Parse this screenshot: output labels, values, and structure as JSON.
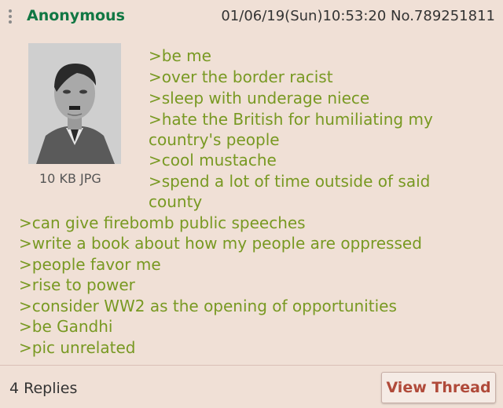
{
  "header": {
    "name": "Anonymous",
    "meta": "01/06/19(Sun)10:53:20 No.789251811"
  },
  "file": {
    "info": "10 KB JPG",
    "thumbnail_icon": "portrait-photo-icon"
  },
  "post": {
    "lines": [
      ">be me",
      ">over the border racist",
      ">sleep with underage niece",
      ">hate the British for humiliating my",
      "country's people",
      ">cool mustache",
      ">spend a lot of time outside of said",
      "county",
      ">can give firebomb public speeches",
      ">write a book about how my people are oppressed",
      ">people favor me",
      ">rise to power",
      ">consider WW2 as the opening of opportunities",
      ">be Gandhi",
      ">pic unrelated"
    ]
  },
  "footer": {
    "replies": "4 Replies",
    "view_thread": "View Thread"
  },
  "colors": {
    "background": "#f0e0d6",
    "name": "#117743",
    "greentext": "#789922",
    "button_text": "#b04a3a"
  }
}
